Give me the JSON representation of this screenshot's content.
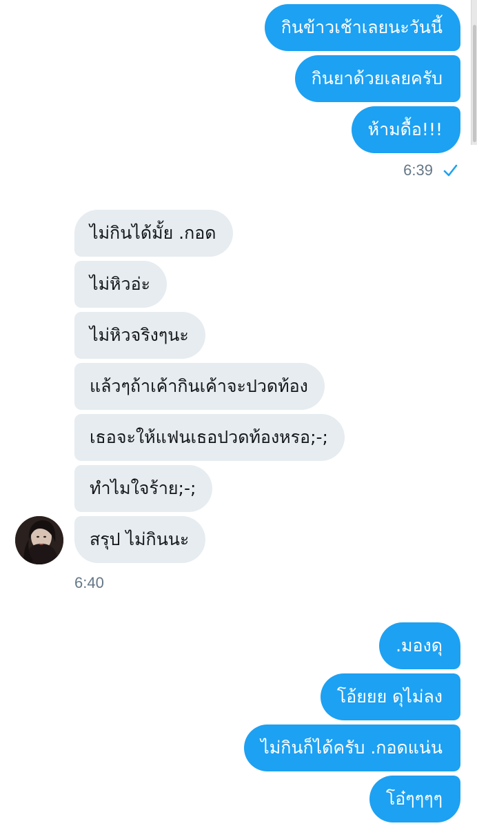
{
  "conversation": {
    "group1_outgoing": [
      "กินข้าวเช้าเลยนะวันนี้",
      "กินยาด้วยเลยครับ",
      "ห้ามดื้อ!!!"
    ],
    "group1_time": "6:39",
    "group2_incoming": [
      "ไม่กินได้มั้ย .กอด",
      "ไม่หิวอ่ะ",
      "ไม่หิวจริงๆนะ",
      "แล้วๆถ้าเค้ากินเค้าจะปวดท้อง",
      "เธอจะให้แฟนเธอปวดท้องหรอ;-;",
      "ทำไมใจร้าย;-;",
      "สรุป ไม่กินนะ"
    ],
    "group2_time": "6:40",
    "group3_outgoing": [
      ".มองดุ",
      "โอ้ยยย ดุไม่ลง",
      "ไม่กินก็ได้ครับ .กอดแน่น",
      "โอ๋ๆๆๆๆ"
    ]
  },
  "icons": {
    "read_receipt": "check-icon",
    "contact_avatar": "avatar"
  },
  "colors": {
    "outgoing_bubble": "#1da1f2",
    "incoming_bubble": "#e6ecf0",
    "timestamp_text": "#657786",
    "check": "#1da1f2"
  }
}
